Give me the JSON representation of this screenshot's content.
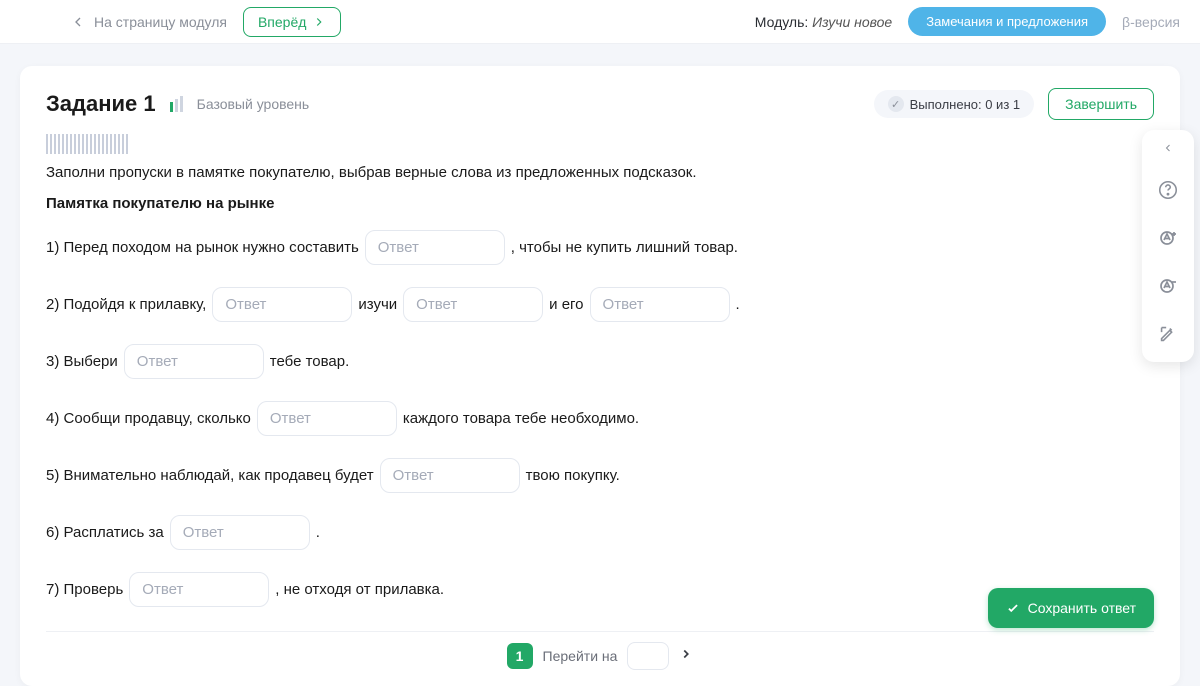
{
  "topbar": {
    "backLabel": "На страницу модуля",
    "forwardLabel": "Вперёд",
    "moduleLabel": "Модуль:",
    "moduleName": "Изучи новое",
    "feedback": "Замечания и предложения",
    "beta": "β-версия"
  },
  "head": {
    "title": "Задание 1",
    "level": "Базовый уровень",
    "status": "Выполнено: 0 из 1",
    "finish": "Завершить"
  },
  "task": {
    "instruction": "Заполни пропуски в памятке покупателю, выбрав верные слова из предложенных подсказок.",
    "subtitle": "Памятка покупателю на рынке",
    "placeholder": "Ответ",
    "lines": {
      "l1a": "1) Перед походом на рынок нужно составить",
      "l1b": ", чтобы не купить лишний товар.",
      "l2a": "2) Подойдя к прилавку,",
      "l2b": "изучи",
      "l2c": "и его",
      "l2d": ".",
      "l3a": "3) Выбери",
      "l3b": "тебе товар.",
      "l4a": "4) Сообщи продавцу, сколько",
      "l4b": "каждого товара тебе необходимо.",
      "l5a": "5) Внимательно наблюдай, как продавец будет",
      "l5b": "твою покупку.",
      "l6a": "6) Расплатись за",
      "l6b": ".",
      "l7a": "7) Проверь",
      "l7b": ", не отходя от прилавка."
    }
  },
  "footer": {
    "page": "1",
    "gotoLabel": "Перейти на"
  },
  "save": "Сохранить ответ"
}
